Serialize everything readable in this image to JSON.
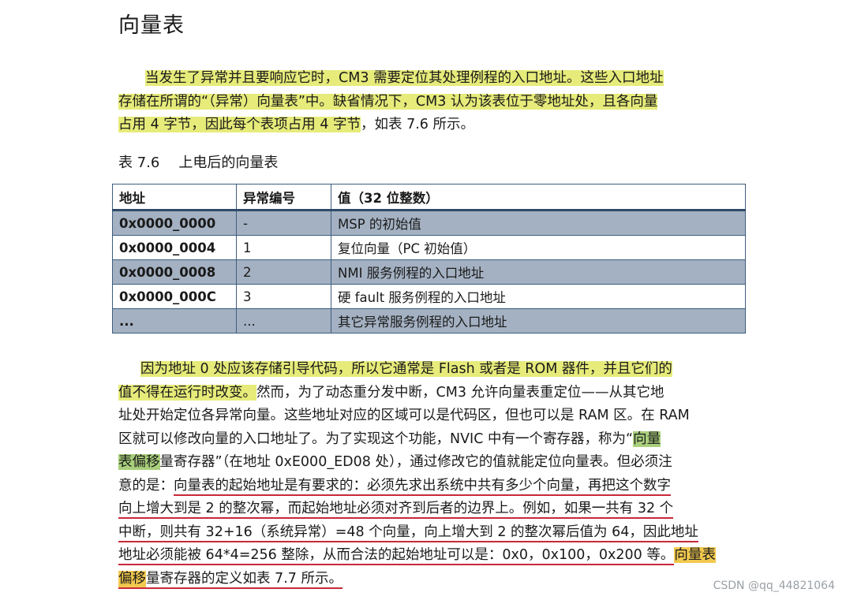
{
  "title": "向量表",
  "para1": {
    "line1": {
      "hl": "当发生了异常并且要响应它时，CM3  需要定位其处理例程的入口地址。这些入口地址"
    },
    "line2": {
      "hl": "存储在所谓的“（异常）向量表”中。缺省情况下，CM3 认为该表位于零地址处，且各向量"
    },
    "line3": {
      "hl": "占用 4 字节，因此每个表项占用 4 字节",
      "rest": "，如表 7.6 所示。"
    }
  },
  "caption": {
    "number": "表 7.6",
    "text": "上电后的向量表"
  },
  "table": {
    "headers": [
      "地址",
      "异常编号",
      "值（32 位整数）"
    ],
    "rows": [
      [
        "0x0000_0000",
        "-",
        "MSP 的初始值"
      ],
      [
        "0x0000_0004",
        "1",
        "复位向量（PC 初始值）"
      ],
      [
        "0x0000_0008",
        "2",
        "NMI  服务例程的入口地址"
      ],
      [
        "0x0000_000C",
        "3",
        "硬 fault 服务例程的入口地址"
      ],
      [
        "...",
        "...",
        "其它异常服务例程的入口地址"
      ]
    ]
  },
  "para2": {
    "line1": {
      "hl": "因为地址 0 处应该存储引导代码，所以它通常是 Flash 或者是 ROM 器件，并且它们的"
    },
    "line2": {
      "hl": "值不得在运行时改变。",
      "rest": "然而，为了动态重分发中断，CM3  允许向量表重定位——从其它地"
    },
    "line3": {
      "text": "址处开始定位各异常向量。这些地址对应的区域可以是代码区，但也可以是 RAM 区。在 RAM"
    },
    "line4": {
      "pre": "区就可以修改向量的入口地址了。为了实现这个功能，NVIC  中有一个寄存器，称为“",
      "hl": "向量"
    },
    "line5": {
      "hl": "表偏移",
      "rest": "量寄存器”（在地址  0xE000_ED08  处），通过修改它的值就能定位向量表。但必须注"
    },
    "line6": {
      "pre": "意的是：",
      "ul": "向量表的起始地址是有要求的：必须先求出系统中共有多少个向量，再把这个数字"
    },
    "line7": {
      "ul": "向上增大到是 2 的整次幂，而起始地址必须对齐到后者的边界上。例如，如果一共有 32 个"
    },
    "line8": {
      "ul": "中断，则共有 32+16（系统异常）=48 个向量，向上增大到 2 的整次幂后值为 64，因此地址"
    },
    "line9": {
      "ul": "地址必须能被 64*4=256 整除，从而合法的起始地址可以是：0x0，0x100，0x200 等。",
      "hl": "向量表"
    },
    "line10": {
      "hl": "偏移",
      "rest": "量寄存器的定义如表 7.7 所示。"
    }
  },
  "watermark": "CSDN @qq_44821064",
  "colors": {
    "highlight_yellow": "#e6eb7a",
    "highlight_orange": "#f2c94f",
    "highlight_green": "#a9cf7c",
    "underline_red": "#c8283a",
    "table_shaded_row": "#a4b1c2",
    "table_border": "#3e5d7e"
  }
}
